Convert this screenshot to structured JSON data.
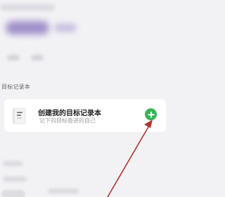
{
  "section": {
    "title": "目标记录本"
  },
  "card": {
    "icon": "notebook-icon",
    "title": "创建我的目标记录本",
    "subtitle": "记下向目标奋进的自己",
    "add_button_icon": "plus-icon",
    "add_button_color": "#37b456"
  },
  "annotation": {
    "arrow_color": "#b2332e"
  }
}
